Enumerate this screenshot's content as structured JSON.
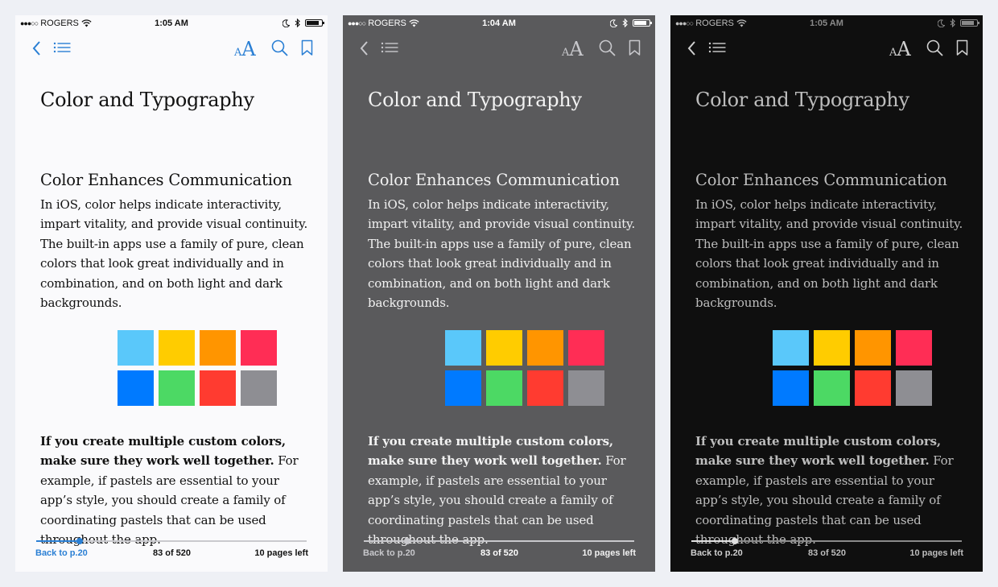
{
  "themes": [
    {
      "name": "white",
      "status": {
        "carrier": "ROGERS",
        "time": "1:05 AM"
      },
      "colors": {
        "bg": "#fafafc",
        "text": "#111111",
        "toolbar": "#2a7fd4",
        "status": "#111111",
        "link": "#2a7fd4",
        "footer": "#111111",
        "track": "#c9c9ce",
        "fill": "#2a7fd4"
      }
    },
    {
      "name": "gray",
      "status": {
        "carrier": "ROGERS",
        "time": "1:04 AM"
      },
      "colors": {
        "bg": "#5a5a5c",
        "text": "#f2f2f2",
        "toolbar": "#c8c8cc",
        "status": "#ffffff",
        "link": "#c8c8cc",
        "footer": "#ffffff",
        "track": "#c8c8cc",
        "fill": "#c8c8cc"
      }
    },
    {
      "name": "night",
      "status": {
        "carrier": "ROGERS",
        "time": "1:05 AM"
      },
      "colors": {
        "bg": "#0f0f0f",
        "text": "#bdbdbd",
        "toolbar": "#cfcfcf",
        "status": "#8a8a8a",
        "link": "#cfcfcf",
        "footer": "#bdbdbd",
        "track": "#8a8a8a",
        "fill": "#e0e0e0"
      }
    }
  ],
  "book": {
    "title": "Color and Typography",
    "heading": "Color Enhances Communication",
    "paragraph1": "In iOS, color helps indicate interactivity, impart vitality, and provide visual continuity. The built-in apps use a family of pure, clean colors that look great individually and in combination, and on both light and dark backgrounds.",
    "paragraph2_bold": "If you create multiple custom colors, make sure they work well together.",
    "paragraph2_rest": " For example, if pastels are essential to your app’s style, you should create a family of coordinating pastels that can be used throughout the app.",
    "swatches": [
      "#5ac8fa",
      "#ffcc00",
      "#ff9500",
      "#ff2d55",
      "#007aff",
      "#4cd964",
      "#ff3b30",
      "#8e8e93"
    ]
  },
  "footer": {
    "back_label": "Back to p.20",
    "page_count": "83 of 520",
    "pages_left": "10 pages left",
    "progress": 0.16
  },
  "toolbar": {
    "aa_small": "A",
    "aa_big": "A"
  },
  "icons": [
    "back-chevron-icon",
    "table-of-contents-icon",
    "font-size-icon",
    "search-icon",
    "bookmark-icon",
    "wifi-icon",
    "bluetooth-icon",
    "moon-icon",
    "battery-icon"
  ]
}
